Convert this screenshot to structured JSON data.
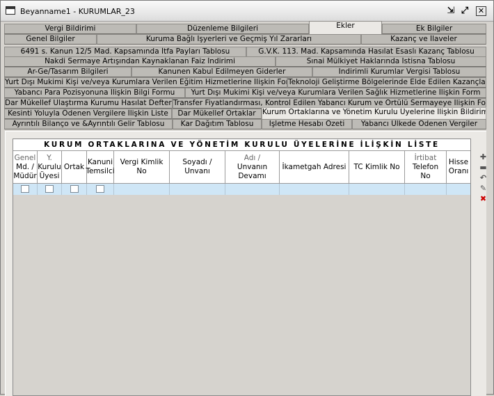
{
  "window": {
    "title": "Beyanname1 - KURUMLAR_23"
  },
  "tabs": [
    {
      "label": "Vergi Bildirimi"
    },
    {
      "label": "Düzenleme Bilgileri"
    },
    {
      "label": "Ekler"
    },
    {
      "label": "Ek Bilgiler"
    },
    {
      "label": "Genel Bilgiler"
    },
    {
      "label": "Kuruma Bağlı İşyerleri ve Geçmiş Yıl Zararları"
    },
    {
      "label": "Kazanç ve İlaveler"
    },
    {
      "label": "6491 s. Kanun 12/5 Mad. Kapsamında İtfa Payları Tablosu"
    },
    {
      "label": "G.V.K. 113. Mad. Kapsamında Hasılat Esaslı Kazanç Tablosu"
    },
    {
      "label": "Nakdi Sermaye Artışından Kaynaklanan Faiz İndirimi"
    },
    {
      "label": "Sınai Mülkiyet Haklarında İstisna Tablosu"
    },
    {
      "label": "Ar-Ge/Tasarım Bilgileri"
    },
    {
      "label": "Kanunen Kabul Edilmeyen Giderler"
    },
    {
      "label": "İndirimli Kurumlar Vergisi Tablosu"
    },
    {
      "label": "Yurt Dışı Mukimi Kişi ve/veya Kurumlara Verilen Eğitim Hizmetlerine İlişkin Form"
    },
    {
      "label": "Teknoloji Geliştirme Bölgelerinde Elde Edilen Kazançlar"
    },
    {
      "label": "Yabancı Para Pozisyonuna İlişkin Bilgi Formu"
    },
    {
      "label": "Yurt Dışı Mukimi Kişi ve/veya Kurumlara Verilen Sağlık Hizmetlerine İlişkin Form"
    },
    {
      "label": "Dar Mükellef Ulaştırma Kurumu Hasılat Defteri"
    },
    {
      "label": "Transfer Fiyatlandırması, Kontrol Edilen Yabancı Kurum ve Örtülü Sermayeye İlişkin Form"
    },
    {
      "label": "Kesinti Yoluyla Ödenen Vergilere İlişkin Liste"
    },
    {
      "label": "Dar Mükellef Ortaklar"
    },
    {
      "label": "Kurum Ortaklarına ve Yönetim Kurulu Üyelerine İlişkin Bildirim"
    },
    {
      "label": "Ayrıntılı Bilanço ve &Ayrıntılı Gelir Tablosu"
    },
    {
      "label": "Kar Dağıtım Tablosu"
    },
    {
      "label": "İşletme Hesabı Özeti"
    },
    {
      "label": "Yabancı Ülkede Ödenen Vergiler"
    }
  ],
  "grid": {
    "title": "KURUM ORTAKLARINA VE YÖNETİM KURULU ÜYELERİNE İLİŞKİN LİSTE",
    "columns": [
      {
        "l1": "Genel",
        "l2": "Md. /",
        "l3": "Müdür"
      },
      {
        "l1": "Y.",
        "l2": "Kurulu",
        "l3": "Üyesi"
      },
      {
        "l1": "",
        "l2": "Ortak",
        "l3": ""
      },
      {
        "l1": "Kanuni",
        "l2": "Temsilci",
        "l3": ""
      },
      {
        "l1": "Vergi Kimlik",
        "l2": "No",
        "l3": ""
      },
      {
        "l1": "",
        "l2": "Soyadı / Unvanı",
        "l3": ""
      },
      {
        "l1": "Adı /",
        "l2": "Unvanın",
        "l3": "Devamı"
      },
      {
        "l1": "",
        "l2": "İkametgah Adresi",
        "l3": ""
      },
      {
        "l1": "",
        "l2": "TC Kimlik No",
        "l3": ""
      },
      {
        "l1": "İrtibat",
        "l2": "Telefon",
        "l3": "No"
      },
      {
        "l1": "Hisse",
        "l2": "Oranı",
        "l3": ""
      }
    ]
  },
  "side_icons": [
    "add-row-icon",
    "remove-row-icon",
    "undo-icon",
    "edit-icon",
    "delete-icon"
  ]
}
